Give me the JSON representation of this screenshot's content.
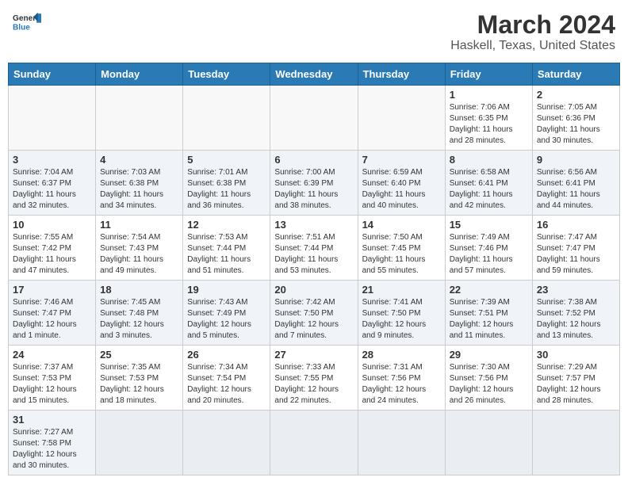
{
  "header": {
    "logo_general": "General",
    "logo_blue": "Blue",
    "month_year": "March 2024",
    "location": "Haskell, Texas, United States"
  },
  "weekdays": [
    "Sunday",
    "Monday",
    "Tuesday",
    "Wednesday",
    "Thursday",
    "Friday",
    "Saturday"
  ],
  "weeks": [
    [
      {
        "day": "",
        "info": ""
      },
      {
        "day": "",
        "info": ""
      },
      {
        "day": "",
        "info": ""
      },
      {
        "day": "",
        "info": ""
      },
      {
        "day": "",
        "info": ""
      },
      {
        "day": "1",
        "info": "Sunrise: 7:06 AM\nSunset: 6:35 PM\nDaylight: 11 hours\nand 28 minutes."
      },
      {
        "day": "2",
        "info": "Sunrise: 7:05 AM\nSunset: 6:36 PM\nDaylight: 11 hours\nand 30 minutes."
      }
    ],
    [
      {
        "day": "3",
        "info": "Sunrise: 7:04 AM\nSunset: 6:37 PM\nDaylight: 11 hours\nand 32 minutes."
      },
      {
        "day": "4",
        "info": "Sunrise: 7:03 AM\nSunset: 6:38 PM\nDaylight: 11 hours\nand 34 minutes."
      },
      {
        "day": "5",
        "info": "Sunrise: 7:01 AM\nSunset: 6:38 PM\nDaylight: 11 hours\nand 36 minutes."
      },
      {
        "day": "6",
        "info": "Sunrise: 7:00 AM\nSunset: 6:39 PM\nDaylight: 11 hours\nand 38 minutes."
      },
      {
        "day": "7",
        "info": "Sunrise: 6:59 AM\nSunset: 6:40 PM\nDaylight: 11 hours\nand 40 minutes."
      },
      {
        "day": "8",
        "info": "Sunrise: 6:58 AM\nSunset: 6:41 PM\nDaylight: 11 hours\nand 42 minutes."
      },
      {
        "day": "9",
        "info": "Sunrise: 6:56 AM\nSunset: 6:41 PM\nDaylight: 11 hours\nand 44 minutes."
      }
    ],
    [
      {
        "day": "10",
        "info": "Sunrise: 7:55 AM\nSunset: 7:42 PM\nDaylight: 11 hours\nand 47 minutes."
      },
      {
        "day": "11",
        "info": "Sunrise: 7:54 AM\nSunset: 7:43 PM\nDaylight: 11 hours\nand 49 minutes."
      },
      {
        "day": "12",
        "info": "Sunrise: 7:53 AM\nSunset: 7:44 PM\nDaylight: 11 hours\nand 51 minutes."
      },
      {
        "day": "13",
        "info": "Sunrise: 7:51 AM\nSunset: 7:44 PM\nDaylight: 11 hours\nand 53 minutes."
      },
      {
        "day": "14",
        "info": "Sunrise: 7:50 AM\nSunset: 7:45 PM\nDaylight: 11 hours\nand 55 minutes."
      },
      {
        "day": "15",
        "info": "Sunrise: 7:49 AM\nSunset: 7:46 PM\nDaylight: 11 hours\nand 57 minutes."
      },
      {
        "day": "16",
        "info": "Sunrise: 7:47 AM\nSunset: 7:47 PM\nDaylight: 11 hours\nand 59 minutes."
      }
    ],
    [
      {
        "day": "17",
        "info": "Sunrise: 7:46 AM\nSunset: 7:47 PM\nDaylight: 12 hours\nand 1 minute."
      },
      {
        "day": "18",
        "info": "Sunrise: 7:45 AM\nSunset: 7:48 PM\nDaylight: 12 hours\nand 3 minutes."
      },
      {
        "day": "19",
        "info": "Sunrise: 7:43 AM\nSunset: 7:49 PM\nDaylight: 12 hours\nand 5 minutes."
      },
      {
        "day": "20",
        "info": "Sunrise: 7:42 AM\nSunset: 7:50 PM\nDaylight: 12 hours\nand 7 minutes."
      },
      {
        "day": "21",
        "info": "Sunrise: 7:41 AM\nSunset: 7:50 PM\nDaylight: 12 hours\nand 9 minutes."
      },
      {
        "day": "22",
        "info": "Sunrise: 7:39 AM\nSunset: 7:51 PM\nDaylight: 12 hours\nand 11 minutes."
      },
      {
        "day": "23",
        "info": "Sunrise: 7:38 AM\nSunset: 7:52 PM\nDaylight: 12 hours\nand 13 minutes."
      }
    ],
    [
      {
        "day": "24",
        "info": "Sunrise: 7:37 AM\nSunset: 7:53 PM\nDaylight: 12 hours\nand 15 minutes."
      },
      {
        "day": "25",
        "info": "Sunrise: 7:35 AM\nSunset: 7:53 PM\nDaylight: 12 hours\nand 18 minutes."
      },
      {
        "day": "26",
        "info": "Sunrise: 7:34 AM\nSunset: 7:54 PM\nDaylight: 12 hours\nand 20 minutes."
      },
      {
        "day": "27",
        "info": "Sunrise: 7:33 AM\nSunset: 7:55 PM\nDaylight: 12 hours\nand 22 minutes."
      },
      {
        "day": "28",
        "info": "Sunrise: 7:31 AM\nSunset: 7:56 PM\nDaylight: 12 hours\nand 24 minutes."
      },
      {
        "day": "29",
        "info": "Sunrise: 7:30 AM\nSunset: 7:56 PM\nDaylight: 12 hours\nand 26 minutes."
      },
      {
        "day": "30",
        "info": "Sunrise: 7:29 AM\nSunset: 7:57 PM\nDaylight: 12 hours\nand 28 minutes."
      }
    ],
    [
      {
        "day": "31",
        "info": "Sunrise: 7:27 AM\nSunset: 7:58 PM\nDaylight: 12 hours\nand 30 minutes."
      },
      {
        "day": "",
        "info": ""
      },
      {
        "day": "",
        "info": ""
      },
      {
        "day": "",
        "info": ""
      },
      {
        "day": "",
        "info": ""
      },
      {
        "day": "",
        "info": ""
      },
      {
        "day": "",
        "info": ""
      }
    ]
  ]
}
